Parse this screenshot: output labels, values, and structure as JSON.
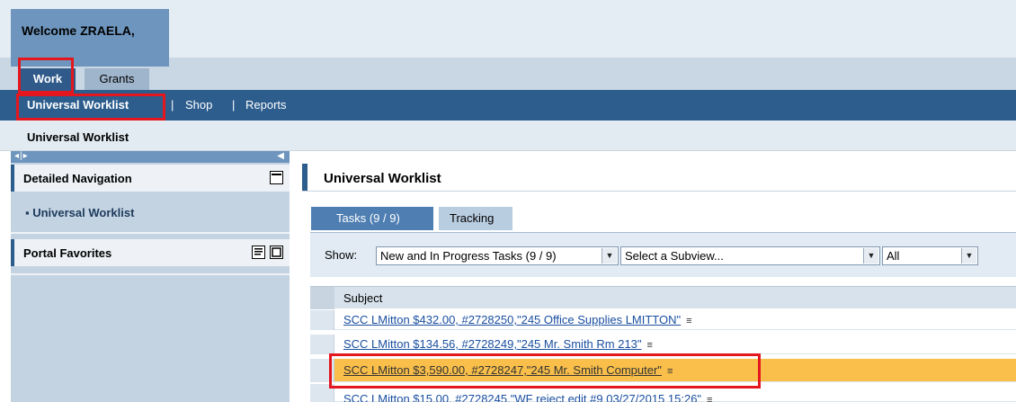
{
  "header": {
    "welcome": "Welcome ZRAELA,"
  },
  "top_tabs": [
    {
      "label": "Work",
      "active": true
    },
    {
      "label": "Grants",
      "active": false
    }
  ],
  "subnav": {
    "items": [
      "Universal Worklist",
      "Shop",
      "Reports"
    ],
    "separator": "|"
  },
  "breadcrumb": "Universal Worklist",
  "left_nav": {
    "toggle": "◂|▸",
    "detailed_nav_title": "Detailed Navigation",
    "nav_item": "▪  Universal Worklist",
    "favorites_title": "Portal Favorites"
  },
  "main": {
    "title": "Universal Worklist",
    "tabs": [
      {
        "label": "Tasks  (9 / 9)",
        "active": true
      },
      {
        "label": "Tracking",
        "active": false
      }
    ],
    "filter": {
      "show_label": "Show:",
      "view_value": "New and In Progress Tasks  (9 / 9)",
      "subview_value": "Select a Subview...",
      "all_value": "All"
    },
    "grid": {
      "column_subject": "Subject",
      "rows": [
        {
          "subject": "SCC LMitton $432.00, #2728250,\"245 Office Supplies LMITTON\"",
          "selected": false
        },
        {
          "subject": "SCC LMitton $134.56, #2728249,\"245 Mr. Smith Rm 213\"",
          "selected": false
        },
        {
          "subject": "SCC LMitton $3,590.00, #2728247,\"245 Mr. Smith Computer\"",
          "selected": true
        },
        {
          "subject": "SCC LMitton $15.00, #2728245,\"WF reject edit #9 03/27/2015 15:26\"",
          "selected": false
        }
      ]
    }
  },
  "colors": {
    "nav_dark": "#2c5d8d",
    "highlight_box": "#e4161e",
    "selected_row": "#f9bf4a"
  }
}
